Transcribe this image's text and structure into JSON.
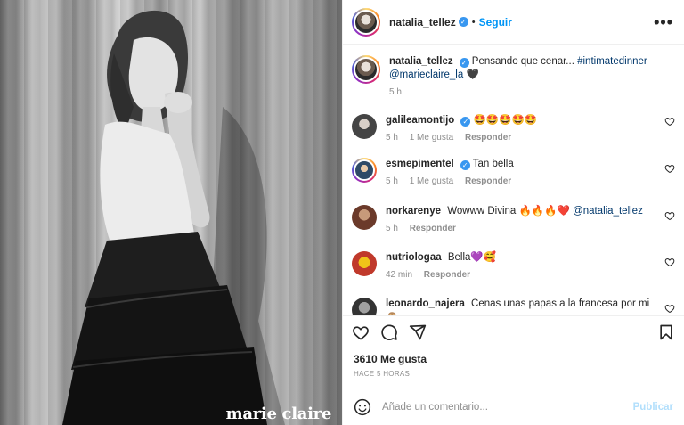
{
  "post": {
    "author": "natalia_tellez",
    "follow_label": "Seguir",
    "more_label": "•••",
    "watermark": "marie claire"
  },
  "caption": {
    "username": "natalia_tellez",
    "text": "Pensando que cenar...",
    "hashtag": "#intimatedinner",
    "mention": "@marieclaire_la",
    "emoji": "🖤",
    "time": "5 h"
  },
  "comments": [
    {
      "username": "galileamontijo",
      "text": "🤩🤩🤩🤩🤩",
      "time": "5 h",
      "likes": "1 Me gusta",
      "reply": "Responder"
    },
    {
      "username": "esmepimentel",
      "text": "Tan bella",
      "time": "5 h",
      "likes": "1 Me gusta",
      "reply": "Responder"
    },
    {
      "username": "norkarenye",
      "text": "Wowww Divina 🔥🔥🔥❤️",
      "mention": "@natalia_tellez",
      "time": "5 h",
      "reply": "Responder"
    },
    {
      "username": "nutriologaa",
      "text": "Bella💜🥰",
      "time": "42 min",
      "reply": "Responder"
    },
    {
      "username": "leonardo_najera",
      "text": "Cenas unas papas a la francesa por mi 🙊"
    }
  ],
  "stats": {
    "likes": "3610 Me gusta",
    "posted_ago": "HACE 5 HORAS"
  },
  "comment_box": {
    "placeholder": "Añade un comentario...",
    "post_label": "Publicar"
  },
  "colors": {
    "link_blue": "#0095f6",
    "verified_blue": "#3897f0",
    "muted": "#8e8e8e"
  },
  "icons": [
    "heart-icon",
    "comment-icon",
    "share-icon",
    "bookmark-icon",
    "emoji-icon",
    "verified-icon"
  ]
}
